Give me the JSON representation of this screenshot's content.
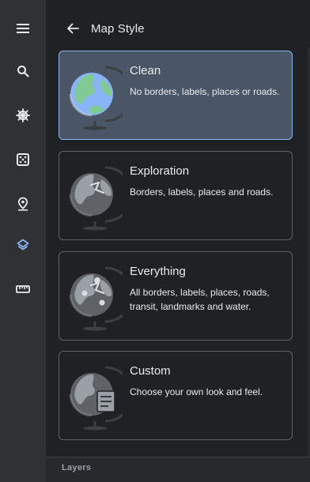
{
  "rail": {
    "items": [
      {
        "icon": "menu-icon",
        "active": false
      },
      {
        "icon": "search-icon",
        "active": false
      },
      {
        "icon": "ship-wheel-icon",
        "active": false
      },
      {
        "icon": "dice-icon",
        "active": false
      },
      {
        "icon": "place-pin-icon",
        "active": false
      },
      {
        "icon": "layers-icon",
        "active": true
      },
      {
        "icon": "ruler-icon",
        "active": false
      }
    ],
    "active_color": "#8ab4f8",
    "icon_color": "#e8eaed"
  },
  "header": {
    "back_icon": "arrow-back-icon",
    "title": "Map Style"
  },
  "styles": [
    {
      "title": "Clean",
      "description": "No borders, labels, places or roads.",
      "selected": true,
      "icon": "globe-clean-icon"
    },
    {
      "title": "Exploration",
      "description": "Borders, labels, places and roads.",
      "selected": false,
      "icon": "globe-exploration-icon"
    },
    {
      "title": "Everything",
      "description": "All borders, labels, places, roads, transit, landmarks and water.",
      "selected": false,
      "icon": "globe-everything-icon"
    },
    {
      "title": "Custom",
      "description": "Choose your own look and feel.",
      "selected": false,
      "icon": "globe-custom-icon"
    }
  ],
  "layers": {
    "label": "Layers"
  },
  "colors": {
    "selected_card": "#4a5566",
    "selected_border": "#8ab4f8",
    "card_border": "#5f6368",
    "rail_bg": "#303134",
    "panel_bg": "#202124"
  }
}
